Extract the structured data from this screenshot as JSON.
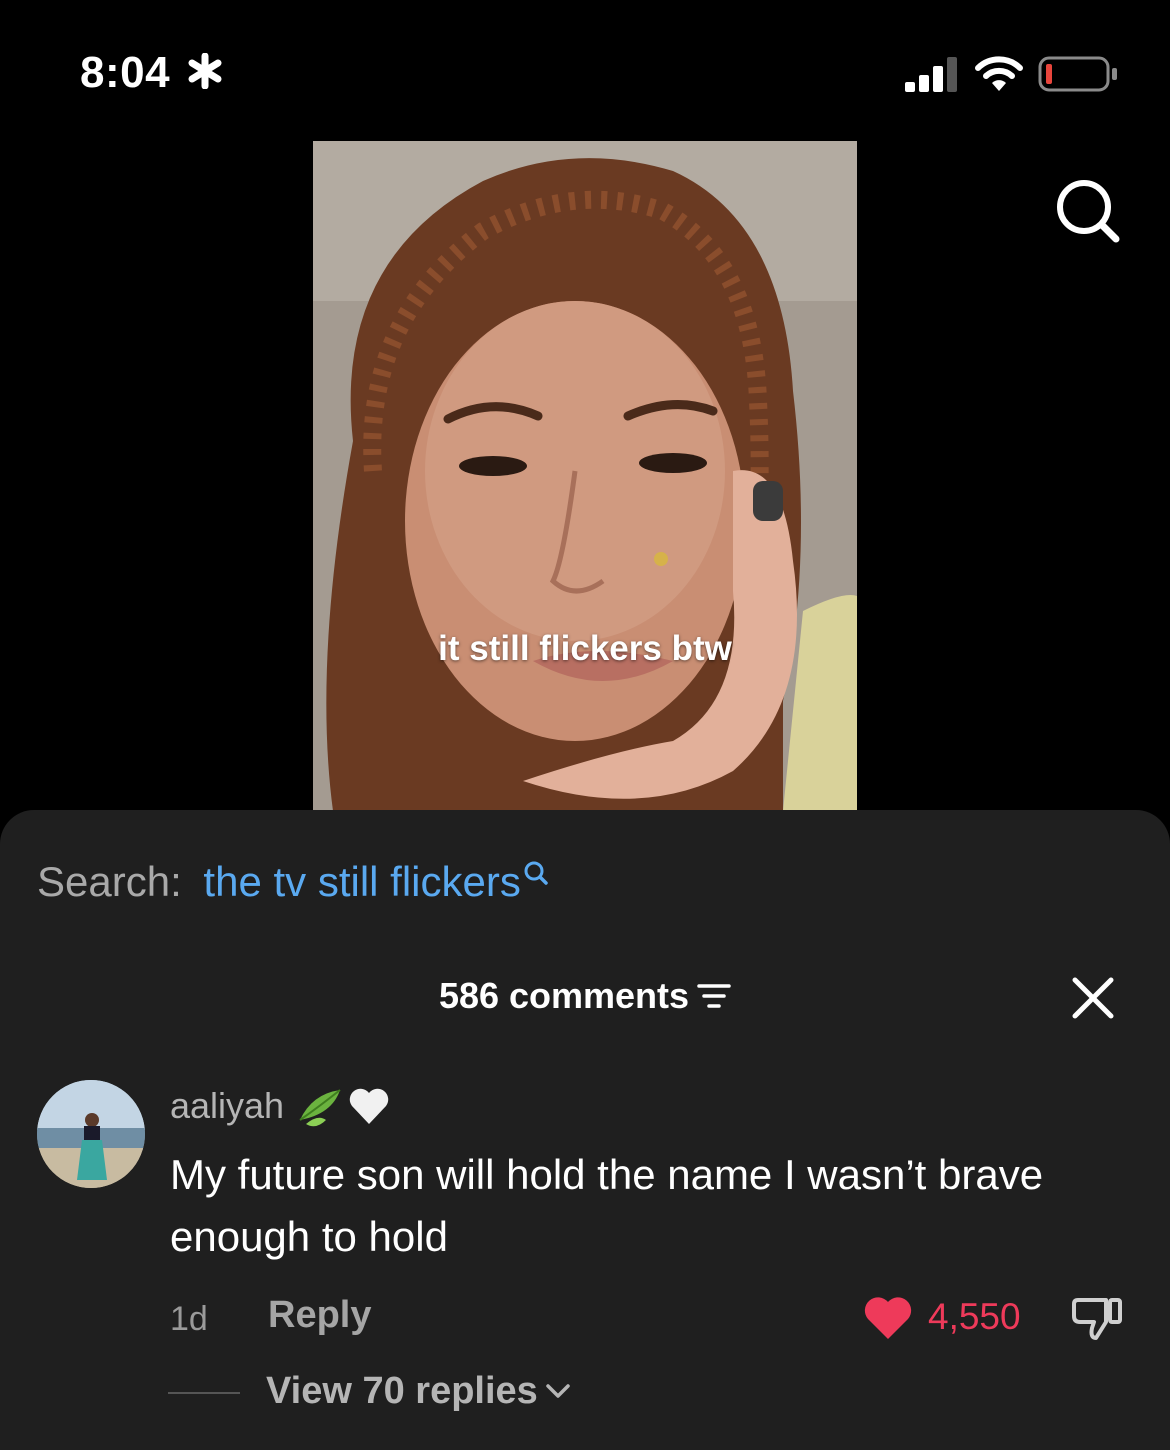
{
  "status_bar": {
    "time": "8:04",
    "focus_glyph": "asterisk-icon"
  },
  "video": {
    "caption": "it still flickers btw"
  },
  "search_row": {
    "prefix": "Search:",
    "query": "the tv still flickers"
  },
  "comments_header": {
    "title": "586 comments"
  },
  "comment": {
    "username": "aaliyah",
    "text": "My future son will hold the name I wasn’t brave enough to hold",
    "age": "1d",
    "reply_label": "Reply",
    "like_count": "4,550",
    "view_replies": "View 70 replies"
  },
  "colors": {
    "accent_link": "#5aa9f0",
    "like_red": "#ee3a5a",
    "sheet_bg": "#1f1f1f"
  }
}
